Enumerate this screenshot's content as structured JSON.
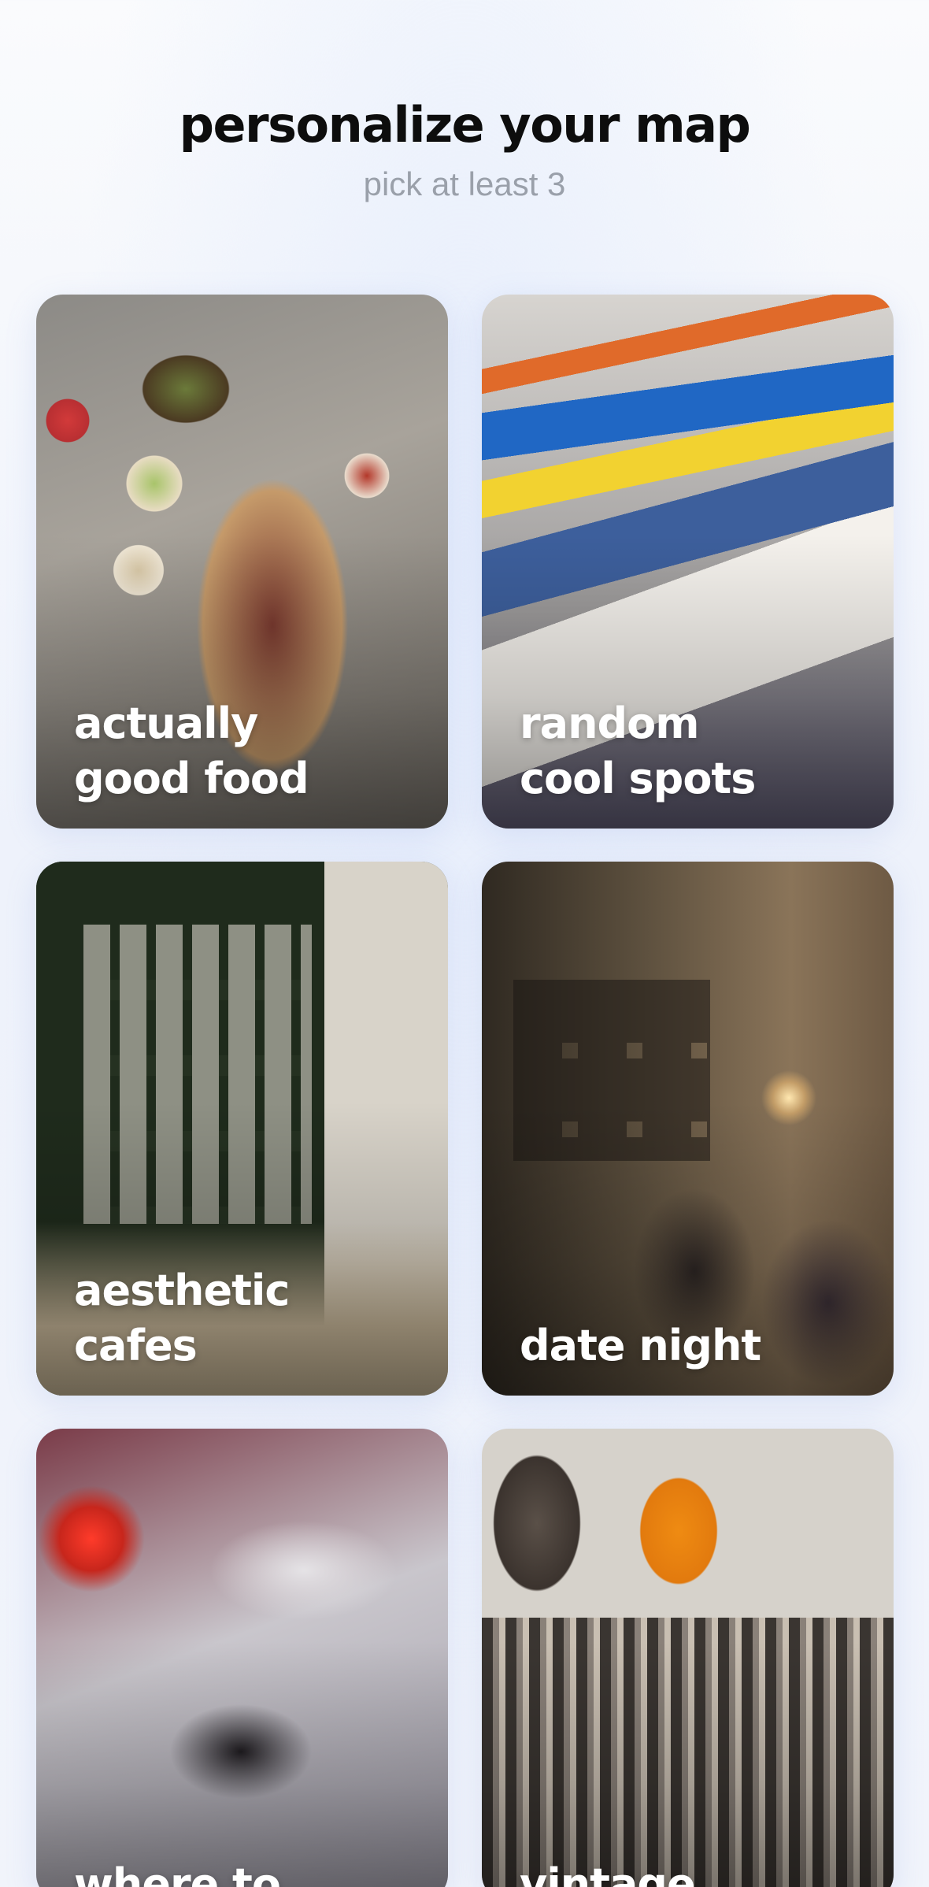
{
  "header": {
    "title": "personalize your map",
    "subtitle": "pick at least 3"
  },
  "categories": [
    {
      "label": "actually\ngood food"
    },
    {
      "label": "random\ncool spots"
    },
    {
      "label": "aesthetic\ncafes"
    },
    {
      "label": "date night"
    },
    {
      "label": "where to"
    },
    {
      "label": "vintage"
    }
  ]
}
